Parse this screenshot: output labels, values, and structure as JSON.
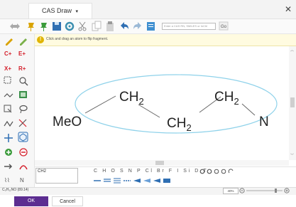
{
  "window": {
    "title": "CAS Draw",
    "title_dropdown": "▾",
    "close_glyph": "✕"
  },
  "toolbar": {
    "search_placeholder": "Enter a CAS RN, SMILES or InChI",
    "icons": [
      "select-arrows-icon",
      "pin-icon",
      "pin-alt-icon",
      "save-icon",
      "settings-icon",
      "cut-icon",
      "copy-icon",
      "paste-icon",
      "undo-icon",
      "redo-icon",
      "import-icon",
      "search-go-icon"
    ]
  },
  "hint": {
    "icon": "!",
    "text": "Click and drag an atom to flip fragment."
  },
  "left_tools": {
    "c_plus": "C+",
    "e_plus": "E+",
    "x_plus": "X+",
    "r_plus": "R+",
    "n_label": "N"
  },
  "structure": {
    "atoms": [
      "MeO",
      "CH",
      "CH",
      "CH",
      "N"
    ],
    "subscript": "2"
  },
  "bottom": {
    "name_value": "CH2",
    "elements": "C H O S N P Cl Br F I Si D T"
  },
  "status": {
    "formula": "C₅H₁₁NO (89.14)",
    "zoom": "40%"
  },
  "footer": {
    "ok_label": "OK",
    "cancel_label": "Cancel"
  },
  "colors": {
    "accent": "#5c2d91",
    "selection": "#8fd2ea",
    "hint_bg": "#fffbe0",
    "atom_red": "#d4202c",
    "bond_green": "#2e8b3b"
  }
}
